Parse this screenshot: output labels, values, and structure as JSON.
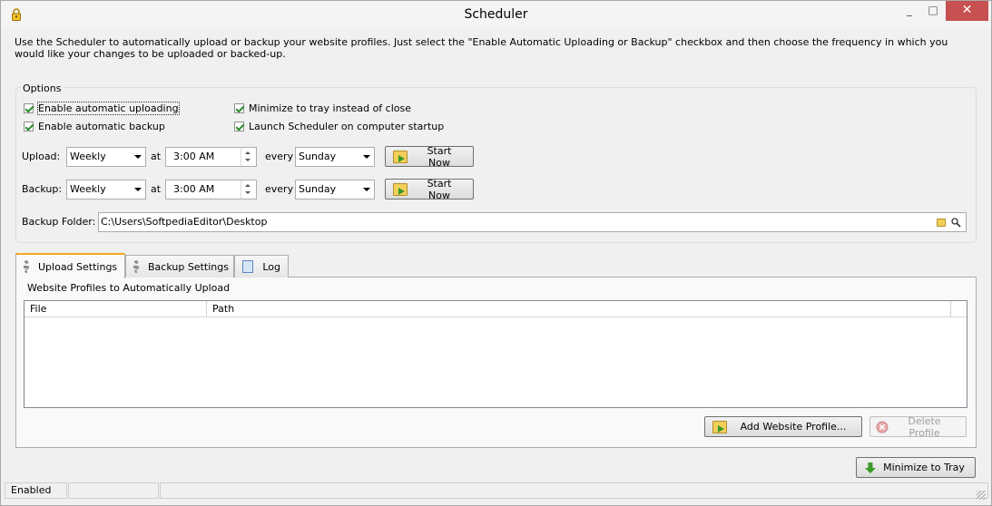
{
  "window": {
    "title": "Scheduler",
    "app_icon": "lock-icon",
    "controls": {
      "minimize": "_",
      "maximize": "□",
      "close": "✕"
    }
  },
  "intro_text": "Use the Scheduler to automatically upload or backup your website profiles. Just select the \"Enable Automatic Uploading or Backup\" checkbox and then choose the frequency in which you would like your changes to be uploaded or backed-up.",
  "options": {
    "legend": "Options",
    "checkboxes": {
      "auto_upload": {
        "label": "Enable automatic uploading",
        "checked": true
      },
      "auto_backup": {
        "label": "Enable automatic backup",
        "checked": true
      },
      "minimize_tray": {
        "label": "Minimize to tray instead of close",
        "checked": true
      },
      "launch_startup": {
        "label": "Launch Scheduler on computer startup",
        "checked": true
      }
    },
    "upload": {
      "label": "Upload:",
      "frequency": "Weekly",
      "at_label": "at",
      "time": "3:00 AM",
      "every_label": "every",
      "day": "Sunday",
      "button": "Start Now"
    },
    "backup": {
      "label": "Backup:",
      "frequency": "Weekly",
      "at_label": "at",
      "time": "3:00 AM",
      "every_label": "every",
      "day": "Sunday",
      "button": "Start Now"
    },
    "backup_folder": {
      "label": "Backup Folder:",
      "value": "C:\\Users\\SoftpediaEditor\\Desktop"
    }
  },
  "tabs": [
    {
      "label": "Upload Settings",
      "icon": "gear-icon",
      "active": true
    },
    {
      "label": "Backup Settings",
      "icon": "gear-icon",
      "active": false
    },
    {
      "label": "Log",
      "icon": "document-icon",
      "active": false
    }
  ],
  "upload_settings": {
    "section_title": "Website Profiles to Automatically Upload",
    "columns": [
      "File",
      "Path"
    ],
    "rows": [],
    "add_button": "Add Website Profile...",
    "delete_button": "Delete Profile"
  },
  "minimize_button": "Minimize to Tray",
  "status": {
    "text": "Enabled"
  },
  "colors": {
    "close_button": "#c75050",
    "active_tab_accent": "#f5a623",
    "check": "#2c8a2c"
  }
}
